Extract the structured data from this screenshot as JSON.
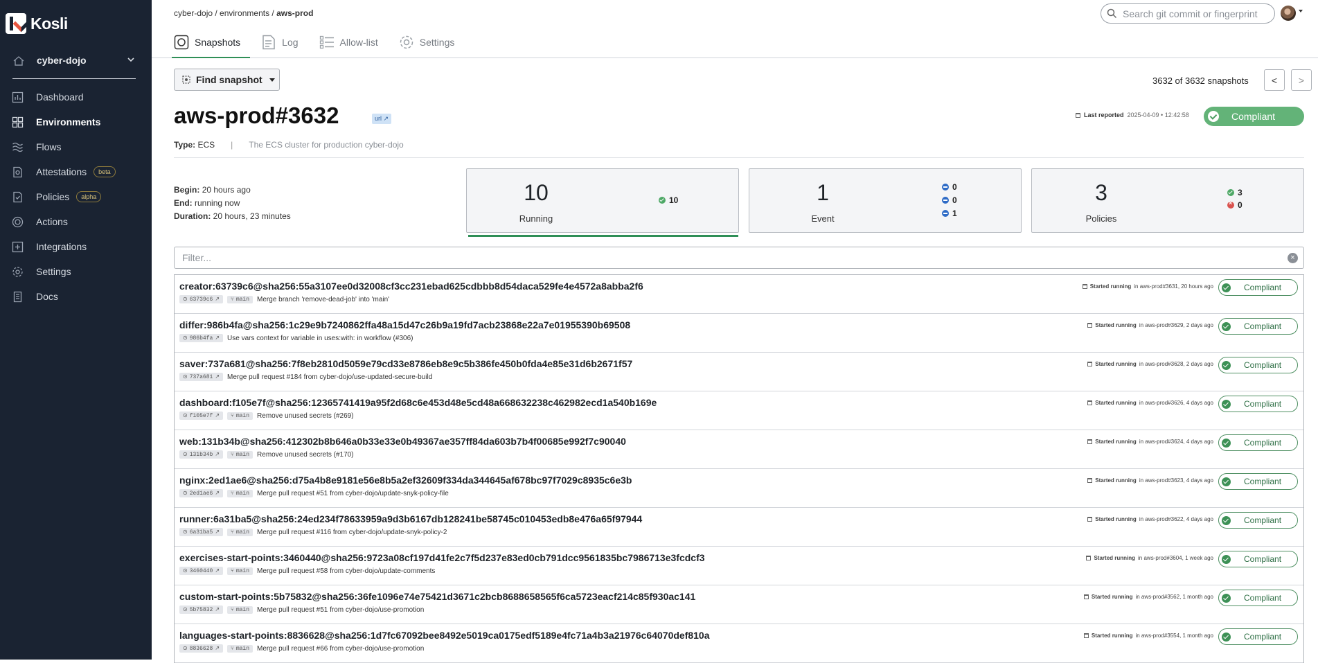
{
  "app": {
    "name": "Kosli"
  },
  "sidebar": {
    "org": "cyber-dojo",
    "items": [
      {
        "label": "Dashboard",
        "icon": "dashboard-icon"
      },
      {
        "label": "Environments",
        "icon": "environments-icon",
        "active": true
      },
      {
        "label": "Flows",
        "icon": "flows-icon"
      },
      {
        "label": "Attestations",
        "icon": "attestations-icon",
        "badge": "beta"
      },
      {
        "label": "Policies",
        "icon": "policies-icon",
        "badge": "alpha"
      },
      {
        "label": "Actions",
        "icon": "actions-icon"
      },
      {
        "label": "Integrations",
        "icon": "integrations-icon"
      },
      {
        "label": "Settings",
        "icon": "settings-icon"
      },
      {
        "label": "Docs",
        "icon": "docs-icon"
      }
    ]
  },
  "header": {
    "breadcrumb": {
      "org": "cyber-dojo",
      "section": "environments",
      "current": "aws-prod"
    },
    "search_placeholder": "Search git commit or fingerprint",
    "tabs": [
      {
        "label": "Snapshots",
        "icon": "camera-icon"
      },
      {
        "label": "Log",
        "icon": "log-icon"
      },
      {
        "label": "Allow-list",
        "icon": "list-icon"
      },
      {
        "label": "Settings",
        "icon": "gear-icon"
      }
    ]
  },
  "snapshot": {
    "find_label": "Find snapshot",
    "count_text": "3632 of 3632 snapshots",
    "prev": "<",
    "next": ">",
    "title": "aws-prod#3632",
    "url_badge": "url",
    "last_reported_label": "Last reported",
    "last_reported_value": "2025-04-09 • 12:42:58",
    "status": "Compliant",
    "type_label": "Type:",
    "type_value": "ECS",
    "separator": "|",
    "description": "The ECS cluster for production cyber-dojo",
    "begin_label": "Begin:",
    "begin_value": "20 hours ago",
    "end_label": "End:",
    "end_value": "running now",
    "duration_label": "Duration:",
    "duration_value": "20 hours, 23 minutes",
    "filter_placeholder": "Filter...",
    "stats": {
      "running": {
        "num": "10",
        "label": "Running",
        "compliant": "10"
      },
      "event": {
        "num": "1",
        "label": "Event",
        "a": "0",
        "b": "0",
        "c": "1"
      },
      "policies": {
        "num": "3",
        "label": "Policies",
        "pass": "3",
        "fail": "0"
      }
    }
  },
  "started_label": "Started running",
  "artifacts": [
    {
      "name": "creator:63739c6@sha256:55a3107ee0d32008cf3cc231ebad625cdbbb8d54daca529fe4e4572a8abba2f6",
      "commit": "63739c6",
      "branch": "main",
      "message": "Merge branch 'remove-dead-job' into 'main'",
      "where": "in aws-prod#3631, 20 hours ago",
      "status": "Compliant"
    },
    {
      "name": "differ:986b4fa@sha256:1c29e9b7240862ffa48a15d47c26b9a19fd7acb23868e22a7e01955390b69508",
      "commit": "986b4fa",
      "branch": "",
      "message": "Use vars context for variable in uses:with: in workflow (#306)",
      "where": "in aws-prod#3629, 2 days ago",
      "status": "Compliant"
    },
    {
      "name": "saver:737a681@sha256:7f8eb2810d5059e79cd33e8786eb8e9c5b386fe450b0fda4e85e31d6b2671f57",
      "commit": "737a681",
      "branch": "",
      "message": "Merge pull request #184 from cyber-dojo/use-updated-secure-build",
      "where": "in aws-prod#3628, 2 days ago",
      "status": "Compliant"
    },
    {
      "name": "dashboard:f105e7f@sha256:12365741419a95f2d68c6e453d48e5cd48a668632238c462982ecd1a540b169e",
      "commit": "f105e7f",
      "branch": "main",
      "message": "Remove unused secrets (#269)",
      "where": "in aws-prod#3626, 4 days ago",
      "status": "Compliant"
    },
    {
      "name": "web:131b34b@sha256:412302b8b646a0b33e33e0b49367ae357ff84da603b7b4f00685e992f7c90040",
      "commit": "131b34b",
      "branch": "main",
      "message": "Remove unused secrets (#170)",
      "where": "in aws-prod#3624, 4 days ago",
      "status": "Compliant"
    },
    {
      "name": "nginx:2ed1ae6@sha256:d75a4b8e9181e56e8b5a2ef32609f334da344645af678bc97f7029c8935c6e3b",
      "commit": "2ed1ae6",
      "branch": "main",
      "message": "Merge pull request #51 from cyber-dojo/update-snyk-policy-file",
      "where": "in aws-prod#3623, 4 days ago",
      "status": "Compliant"
    },
    {
      "name": "runner:6a31ba5@sha256:24ed234f78633959a9d3b6167db128241be58745c010453edb8e476a65f97944",
      "commit": "6a31ba5",
      "branch": "main",
      "message": "Merge pull request #116 from cyber-dojo/update-snyk-policy-2",
      "where": "in aws-prod#3622, 4 days ago",
      "status": "Compliant"
    },
    {
      "name": "exercises-start-points:3460440@sha256:9723a08cf197d41fe2c7f5d237e83ed0cb791dcc9561835bc7986713e3fcdcf3",
      "commit": "3460440",
      "branch": "main",
      "message": "Merge pull request #58 from cyber-dojo/update-comments",
      "where": "in aws-prod#3604, 1 week ago",
      "status": "Compliant"
    },
    {
      "name": "custom-start-points:5b75832@sha256:36fe1096e74e75421d3671c2bcb8688658565f6ca5723eacf214c85f930ac141",
      "commit": "5b75832",
      "branch": "main",
      "message": "Merge pull request #51 from cyber-dojo/use-promotion",
      "where": "in aws-prod#3562, 1 month ago",
      "status": "Compliant"
    },
    {
      "name": "languages-start-points:8836628@sha256:1d7fc67092bee8492e5019ca0175edf5189e4fc71a4b3a21976c64070def810a",
      "commit": "8836628",
      "branch": "main",
      "message": "Merge pull request #66 from cyber-dojo/use-promotion",
      "where": "in aws-prod#3554, 1 month ago",
      "status": "Compliant"
    }
  ]
}
